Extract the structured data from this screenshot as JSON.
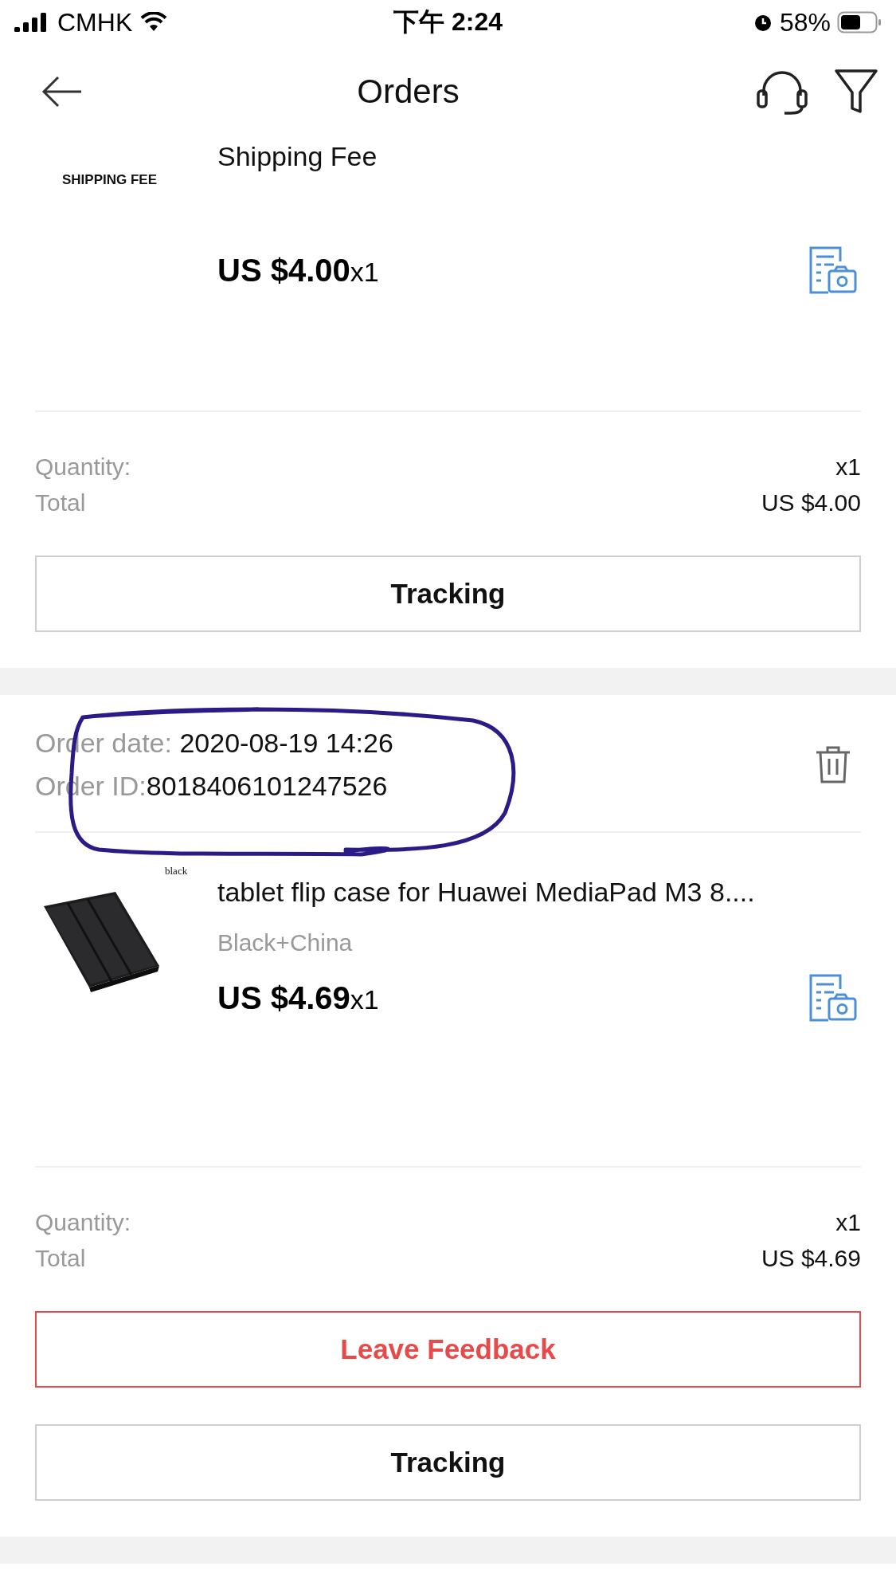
{
  "status_bar": {
    "carrier": "CMHK",
    "time": "下午 2:24",
    "battery": "58%"
  },
  "header": {
    "title": "Orders"
  },
  "orders": [
    {
      "items": [
        {
          "kind": "text_thumb",
          "thumbnail_text": "SHIPPING FEE",
          "title": "Shipping Fee",
          "price": "US $4.00",
          "quantity": "x1"
        }
      ],
      "summary": [
        {
          "label": "Quantity:",
          "value": "x1"
        },
        {
          "label": "Total",
          "value": "US $4.00"
        }
      ],
      "buttons": [
        {
          "label": "Tracking",
          "kind": "default"
        }
      ]
    },
    {
      "order_date_label": "Order date: ",
      "order_date": "2020-08-19 14:26",
      "order_id_label": "Order ID:",
      "order_id": "8018406101247526",
      "circled": true,
      "items": [
        {
          "kind": "picture",
          "image_tag": "black",
          "title": "tablet flip case for Huawei MediaPad M3 8....",
          "variant": "Black+China",
          "price": "US $4.69",
          "quantity": "x1"
        }
      ],
      "summary": [
        {
          "label": "Quantity:",
          "value": "x1"
        },
        {
          "label": "Total",
          "value": "US $4.69"
        }
      ],
      "buttons": [
        {
          "label": "Leave Feedback",
          "kind": "feedback"
        },
        {
          "label": "Tracking",
          "kind": "default"
        }
      ]
    }
  ]
}
